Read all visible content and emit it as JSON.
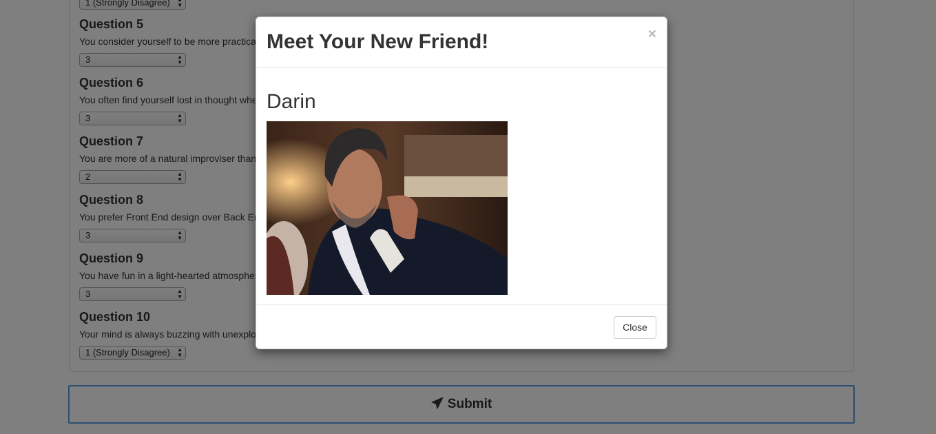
{
  "survey": {
    "top_select_value": "1 (Strongly Disagree)",
    "questions": [
      {
        "title": "Question 5",
        "text": "You consider yourself to be more practical than creative.",
        "value": "3"
      },
      {
        "title": "Question 6",
        "text": "You often find yourself lost in thought when you are walking in nature.",
        "value": "3"
      },
      {
        "title": "Question 7",
        "text": "You are more of a natural improviser than a careful planner.",
        "value": "2"
      },
      {
        "title": "Question 8",
        "text": "You prefer Front End design over Back End development.",
        "value": "3"
      },
      {
        "title": "Question 9",
        "text": "You have fun in a light-hearted atmosphere.",
        "value": "3"
      },
      {
        "title": "Question 10",
        "text": "Your mind is always buzzing with unexplored ideas and plans.",
        "value": "1 (Strongly Disagree)"
      }
    ],
    "submit_label": "Submit"
  },
  "modal": {
    "title": "Meet Your New Friend!",
    "close_symbol": "×",
    "friend_name": "Darin",
    "close_button_label": "Close"
  },
  "colors": {
    "backdrop": "rgba(0,0,0,0.5)",
    "submit_border": "#5b9ce6"
  }
}
